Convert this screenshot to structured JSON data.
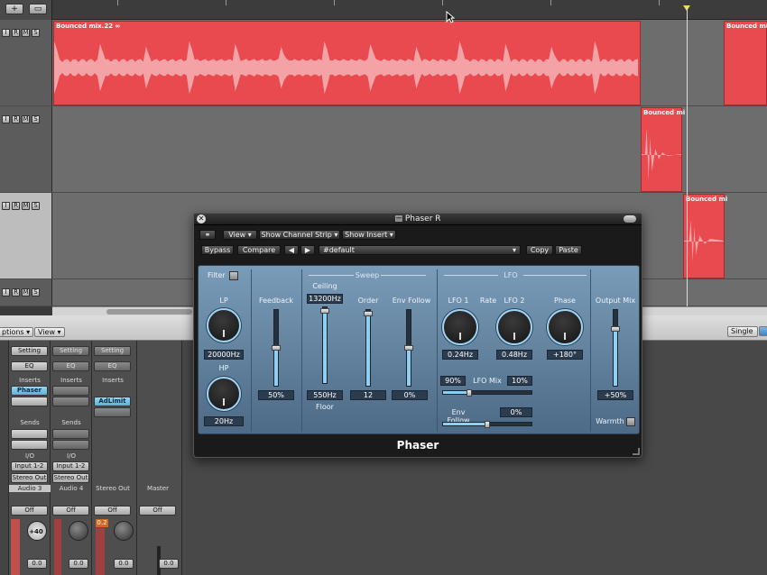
{
  "toolbar": {
    "add_label": "+"
  },
  "tracks": {
    "rows": [
      {
        "i": "I",
        "r": "R",
        "m": "M",
        "s": "S"
      },
      {
        "i": "I",
        "r": "R",
        "m": "M",
        "s": "S"
      },
      {
        "i": "I",
        "r": "R",
        "m": "M",
        "s": "S"
      },
      {
        "i": "I",
        "r": "R",
        "m": "M",
        "s": "S"
      }
    ],
    "regions": [
      {
        "name": "Bounced mix.22 ∞"
      },
      {
        "name": "Bounced mix"
      },
      {
        "name": "Bounced mi"
      },
      {
        "name": "Bounced mi"
      }
    ]
  },
  "mixer_header": {
    "options_label": "ptions ▾",
    "view_label": "View ▾",
    "single_label": "Single"
  },
  "mixer": {
    "strips": [
      {
        "setting": "Setting",
        "eq": "EQ",
        "inserts": "Inserts",
        "insert": "Phaser",
        "sends": "Sends",
        "io": "I/O",
        "input": "Input 1-2",
        "output": "Stereo Out",
        "name": "Audio 3",
        "auto": "Off",
        "pan": "+40",
        "level": "0.0"
      },
      {
        "setting": "Setting",
        "eq": "EQ",
        "inserts": "Inserts",
        "insert": "",
        "sends": "Sends",
        "io": "I/O",
        "input": "Input 1-2",
        "output": "Stereo Out",
        "name": "Audio 4",
        "auto": "Off",
        "pan": "",
        "level": "0.0"
      },
      {
        "setting": "Setting",
        "eq": "EQ",
        "inserts": "Inserts",
        "insert": "AdLimit",
        "sends": "",
        "io": "",
        "input": "",
        "output": "",
        "name": "Stereo Out",
        "auto": "Off",
        "pan": "",
        "level": "0.0",
        "peak": "0.2"
      },
      {
        "setting": "",
        "eq": "",
        "inserts": "",
        "insert": "",
        "sends": "",
        "io": "",
        "input": "",
        "output": "",
        "name": "Master",
        "auto": "Off",
        "pan": "",
        "level": "0.0"
      }
    ]
  },
  "plugin": {
    "title": "Phaser R",
    "name": "Phaser",
    "view_label": "View",
    "channel_strip_label": "Show Channel Strip",
    "show_insert_label": "Show Insert",
    "bypass_label": "Bypass",
    "compare_label": "Compare",
    "prev_label": "◀",
    "next_label": "▶",
    "preset": "#default",
    "copy_label": "Copy",
    "paste_label": "Paste",
    "filter_label": "Filter",
    "lp_label": "LP",
    "lp_value": "20000Hz",
    "hp_label": "HP",
    "hp_value": "20Hz",
    "feedback_label": "Feedback",
    "feedback_value": "50%",
    "sweep_label": "Sweep",
    "ceiling_label": "Ceiling",
    "ceiling_value": "13200Hz",
    "floor_value": "550Hz",
    "floor_label": "Floor",
    "order_label": "Order",
    "order_value": "12",
    "envfollow_label": "Env Follow",
    "envfollow_value": "0%",
    "lfo_label": "LFO",
    "lfo1_label": "LFO 1",
    "rate_label": "Rate",
    "lfo2_label": "LFO 2",
    "lfo1_value": "0.24Hz",
    "lfo2_value": "0.48Hz",
    "phase_label": "Phase",
    "phase_value": "+180°",
    "lfomix_label": "LFO Mix",
    "lfomix_left": "90%",
    "lfomix_right": "10%",
    "lfo_envfollow_label": "Env Follow",
    "lfo_envfollow_value": "0%",
    "output_mix_label": "Output Mix",
    "output_mix_value": "+50%",
    "warmth_label": "Warmth",
    "levels": {
      "feedback": 0.5,
      "ceiling": 0.95,
      "floor": 0.3,
      "order": 0.95,
      "envfollow": 0.5,
      "output_mix": 0.75,
      "lfomix": 0.3,
      "lfo_envfollow": 0.5
    }
  },
  "colors": {
    "region": "#e84a50",
    "plugin_panel": "#6a8cac",
    "accent": "#8fd0f2"
  }
}
